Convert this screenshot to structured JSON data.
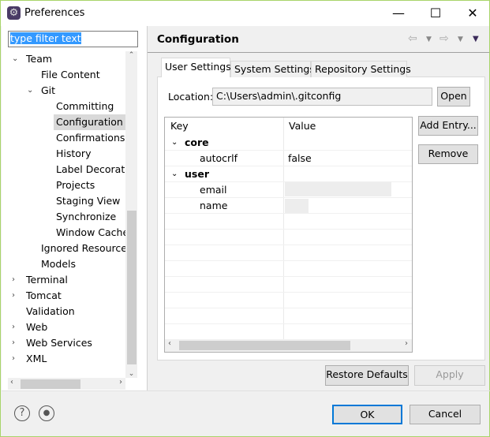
{
  "window": {
    "title": "Preferences",
    "minimize": "—",
    "maximize": "☐",
    "close": "✕"
  },
  "filter": {
    "value": "type filter text"
  },
  "tree": [
    {
      "label": "Team",
      "level": 0,
      "expanded": true
    },
    {
      "label": "File Content",
      "level": 1
    },
    {
      "label": "Git",
      "level": 1,
      "expanded": true
    },
    {
      "label": "Committing",
      "level": 2
    },
    {
      "label": "Configuration",
      "level": 2,
      "selected": true
    },
    {
      "label": "Confirmations a",
      "level": 2
    },
    {
      "label": "History",
      "level": 2
    },
    {
      "label": "Label Decoratio",
      "level": 2
    },
    {
      "label": "Projects",
      "level": 2
    },
    {
      "label": "Staging View",
      "level": 2
    },
    {
      "label": "Synchronize",
      "level": 2
    },
    {
      "label": "Window Cache",
      "level": 2
    },
    {
      "label": "Ignored Resource",
      "level": 1
    },
    {
      "label": "Models",
      "level": 1
    },
    {
      "label": "Terminal",
      "level": 0,
      "expanded": false
    },
    {
      "label": "Tomcat",
      "level": 0,
      "expanded": false
    },
    {
      "label": "Validation",
      "level": 0
    },
    {
      "label": "Web",
      "level": 0,
      "expanded": false
    },
    {
      "label": "Web Services",
      "level": 0,
      "expanded": false
    },
    {
      "label": "XML",
      "level": 0,
      "expanded": false
    }
  ],
  "page": {
    "title": "Configuration",
    "tabs": [
      {
        "label": "User Settings",
        "active": true
      },
      {
        "label": "System Settings"
      },
      {
        "label": "Repository Settings"
      }
    ],
    "location_label": "Location:",
    "location_value": "C:\\Users\\admin\\.gitconfig",
    "open": "Open",
    "table": {
      "headers": [
        "Key",
        "Value"
      ],
      "rows": [
        {
          "key": "core",
          "section": true
        },
        {
          "key": "autocrlf",
          "value": "false"
        },
        {
          "key": "user",
          "section": true
        },
        {
          "key": "email",
          "value": ""
        },
        {
          "key": "name",
          "value": ""
        }
      ]
    },
    "add_entry": "Add Entry...",
    "remove": "Remove",
    "restore_defaults": "Restore Defaults",
    "apply": "Apply"
  },
  "footer": {
    "ok": "OK",
    "cancel": "Cancel",
    "help": "?"
  }
}
